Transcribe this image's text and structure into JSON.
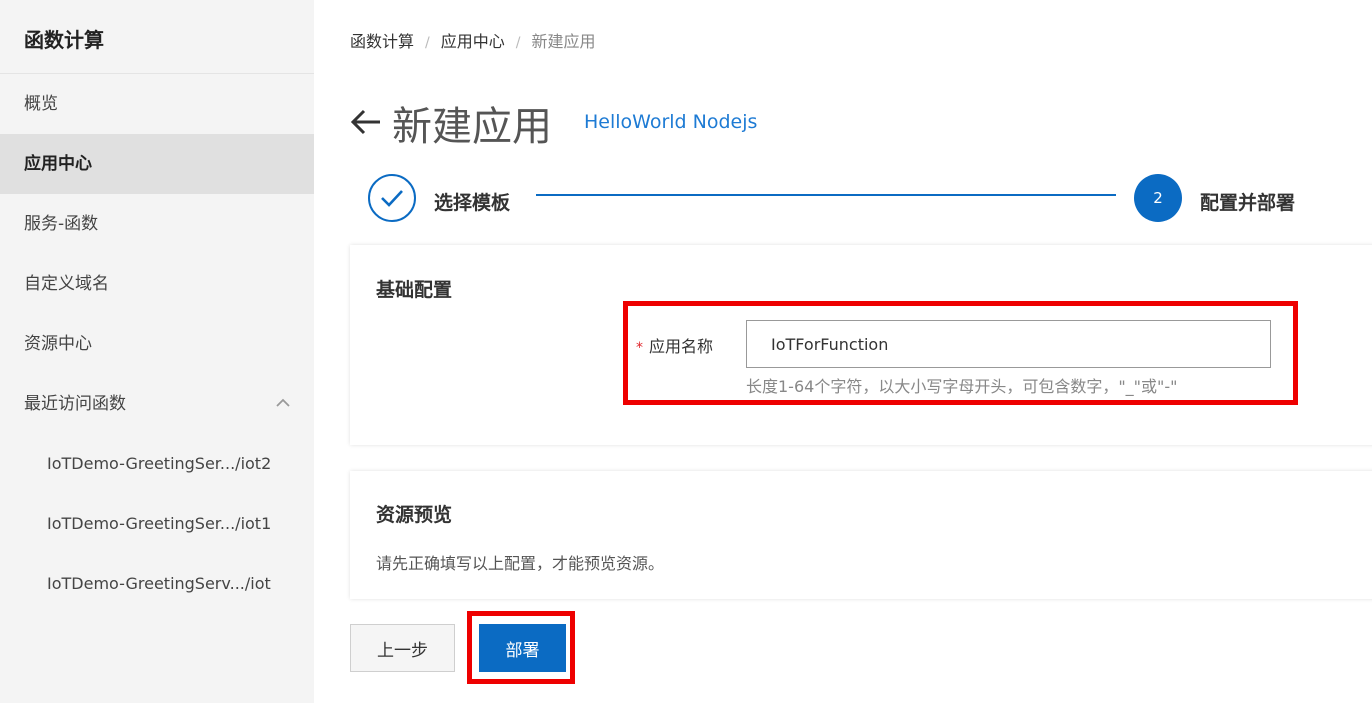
{
  "sidebar": {
    "title": "函数计算",
    "items": [
      {
        "label": "概览"
      },
      {
        "label": "应用中心",
        "active": true
      },
      {
        "label": "服务-函数"
      },
      {
        "label": "自定义域名"
      },
      {
        "label": "资源中心"
      },
      {
        "label": "最近访问函数",
        "icon": "chevron-up-icon"
      }
    ],
    "recent": [
      {
        "label": "IoTDemo-GreetingSer.../iot2"
      },
      {
        "label": "IoTDemo-GreetingSer.../iot1"
      },
      {
        "label": "IoTDemo-GreetingServ.../iot"
      }
    ]
  },
  "breadcrumb": {
    "items": [
      "函数计算",
      "应用中心",
      "新建应用"
    ],
    "separator": "/"
  },
  "page": {
    "title": "新建应用",
    "template_name": "HelloWorld Nodejs"
  },
  "steps": [
    {
      "label": "选择模板",
      "status": "done",
      "icon": "check-icon"
    },
    {
      "number": "2",
      "label": "配置并部署",
      "status": "active"
    }
  ],
  "basic_config": {
    "heading": "基础配置",
    "field": {
      "required_mark": "*",
      "label": "应用名称",
      "value": "IoTForFunction",
      "hint": "长度1-64个字符，以大小写字母开头，可包含数字，\"_\"或\"-\""
    }
  },
  "resource_preview": {
    "heading": "资源预览",
    "text": "请先正确填写以上配置，才能预览资源。"
  },
  "buttons": {
    "prev": "上一步",
    "deploy": "部署"
  },
  "colors": {
    "accent": "#0b6bc3",
    "link": "#1e7bd4",
    "highlight": "#ee0000",
    "brand": "#ff6a00"
  }
}
